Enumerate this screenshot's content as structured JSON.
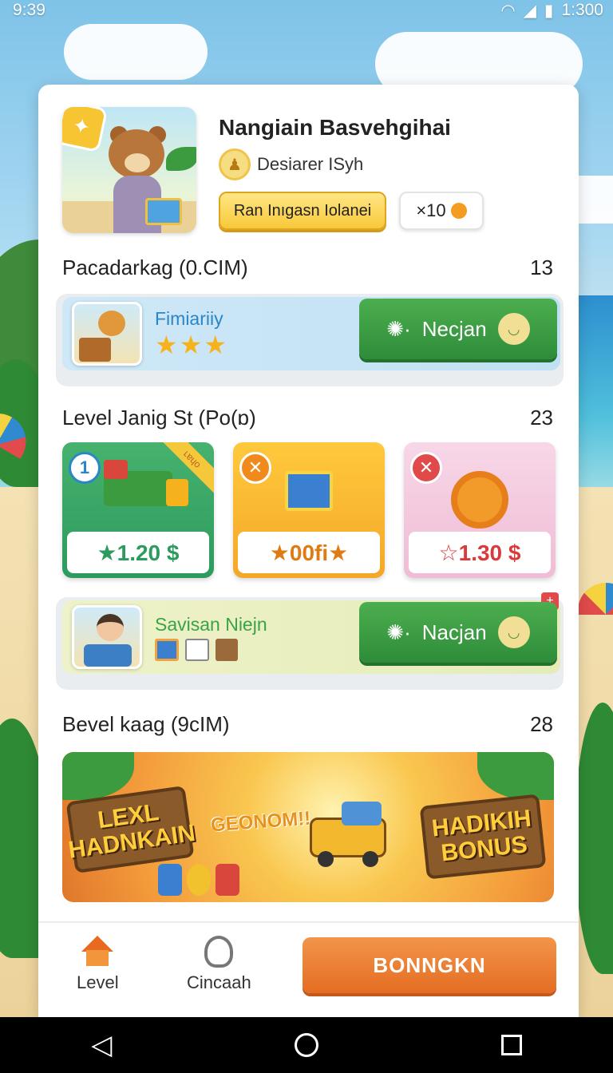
{
  "status_bar": {
    "time": "9:39",
    "right_text": "1:300"
  },
  "header": {
    "title": "Nangiain Basvehgihai",
    "subtitle": "Desiarer ISyh",
    "primary_pill": "Ran Inıgasn Iolanei",
    "multiplier": "×10"
  },
  "sections": [
    {
      "label": "Pacadarkag (0.CIM)",
      "count": "13"
    },
    {
      "label": "Level  Janig St (Po(ɒ)",
      "count": "23"
    },
    {
      "label": "Bevel kaag (9cIM)",
      "count": "28"
    }
  ],
  "offer1": {
    "name": "Fimiariiy",
    "stars": "★★★",
    "button": "Necjan"
  },
  "tiles": [
    {
      "badge": "1",
      "ribbon": "ʟɐɥo",
      "price": "★1.20 $",
      "color": "#2d9a5e"
    },
    {
      "badge": "✕",
      "price": "★00fi★",
      "color": "#f08a1c"
    },
    {
      "badge": "✕",
      "price": "☆1.30 $",
      "color": "#e04a4a"
    }
  ],
  "offer2": {
    "name": "Savisan Niejn",
    "button": "Nacjan"
  },
  "banner": {
    "left_sign": "LEXL HADNKAIN",
    "middle_text": "GEONOM!!",
    "right_sign": "HADIKIH BONUS"
  },
  "bottom_nav": [
    {
      "label": "Level",
      "icon": "house-icon"
    },
    {
      "label": "Cincaah",
      "icon": "trophy-icon"
    }
  ],
  "cta_label": "BONNGKN",
  "colors": {
    "green": "#2e8c39",
    "orange": "#e46d22",
    "yellow": "#f8c83a"
  }
}
